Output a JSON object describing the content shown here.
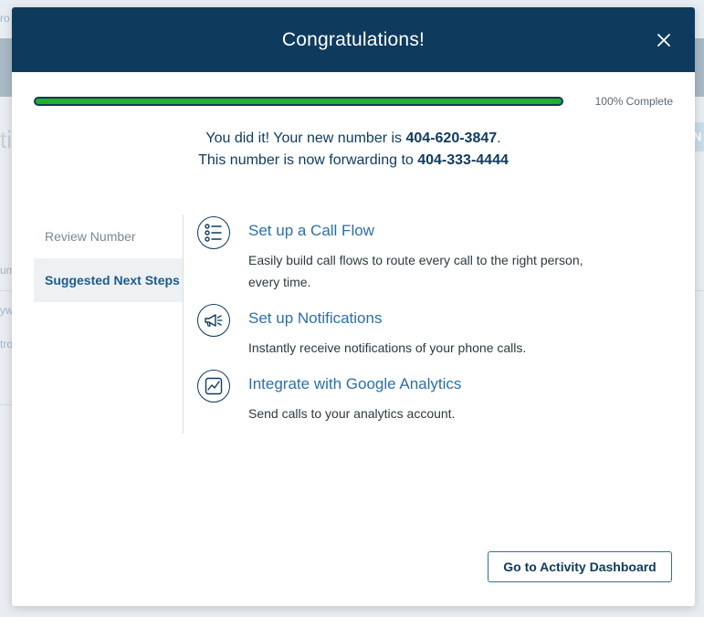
{
  "background": {
    "fragments": [
      "ro",
      "ti",
      "um",
      "yw",
      "tro"
    ],
    "button_fragment": "N"
  },
  "modal": {
    "title": "Congratulations!",
    "progress": {
      "percent": 100,
      "label": "100% Complete"
    },
    "message": {
      "line1_prefix": "You did it! Your new number is ",
      "new_number": "404-620-3847",
      "line1_suffix": ".",
      "line2_prefix": "This number is now forwarding to ",
      "forward_number": "404-333-4444"
    },
    "side_nav": [
      {
        "label": "Review Number",
        "active": false
      },
      {
        "label": "Suggested Next Steps",
        "active": true
      }
    ],
    "steps": [
      {
        "icon": "list-icon",
        "title": "Set up a Call Flow",
        "description": "Easily build call flows to route every call to the right person, every time."
      },
      {
        "icon": "megaphone-icon",
        "title": "Set up Notifications",
        "description": "Instantly receive notifications of your phone calls."
      },
      {
        "icon": "analytics-chart-icon",
        "title": "Integrate with Google Analytics",
        "description": "Send calls to your analytics account."
      }
    ],
    "dashboard_button": "Go to Activity Dashboard"
  },
  "colors": {
    "header": "#0e3a5e",
    "progress_fill": "#1fb12b",
    "link": "#2b6fa8"
  }
}
